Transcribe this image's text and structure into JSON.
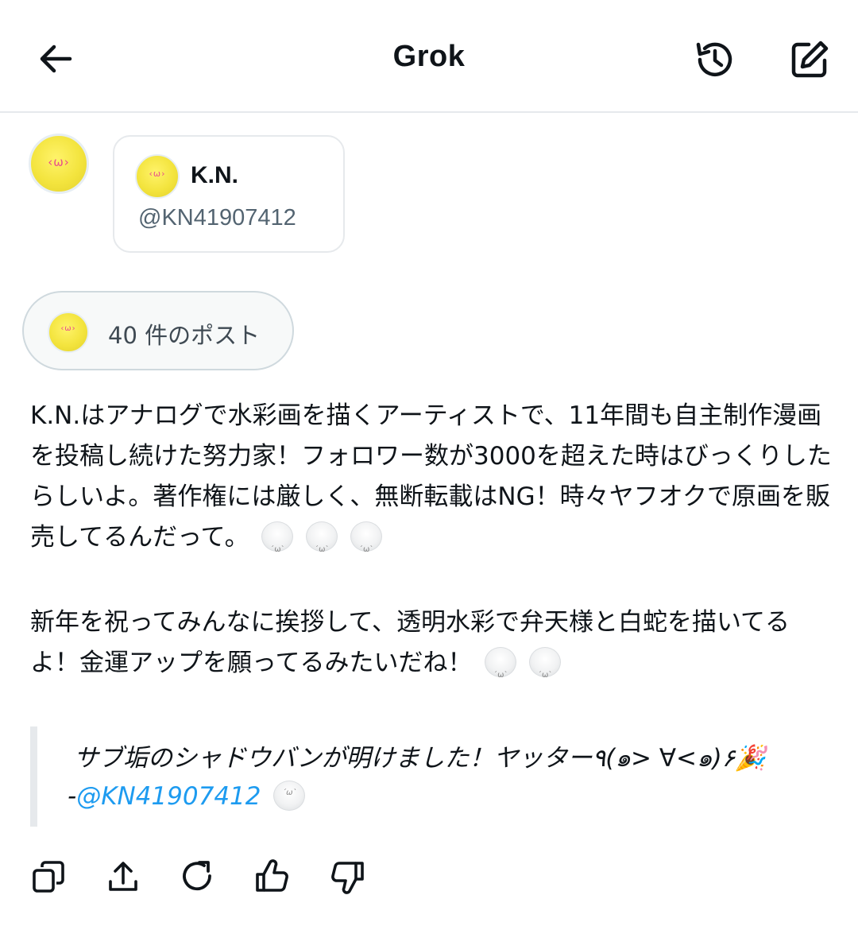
{
  "header": {
    "title": "Grok",
    "back_icon": "arrow-left-icon",
    "history_icon": "history-icon",
    "compose_icon": "compose-icon"
  },
  "user_card": {
    "name": "K.N.",
    "handle": "@KN41907412"
  },
  "posts_chip": {
    "label": "40 件のポスト"
  },
  "response": {
    "paragraph1": "K.N.はアナログで水彩画を描くアーティストで、11年間も自主制作漫画を投稿し続けた努力家！フォロワー数が3000を超えた時はびっくりしたらしいよ。著作権には厳しく、無断転載はNG！時々ヤフオクで原画を販売してるんだって。",
    "paragraph2": "新年を祝ってみんなに挨拶して、透明水彩で弁天様と白蛇を描いてるよ！金運アップを願ってるみたいだね！"
  },
  "quote": {
    "text": "サブ垢のシャドウバンが明けました！ヤッター٩(๑> ∀<๑)۶🎉",
    "dash": "-",
    "link": "@KN41907412"
  },
  "actions": {
    "icons": [
      "copy-icon",
      "share-icon",
      "regenerate-icon",
      "thumbs-up-icon",
      "thumbs-down-icon"
    ]
  },
  "colors": {
    "text": "#0f1419",
    "secondary": "#536471",
    "link": "#1d9bf0",
    "border": "#e6e9ec"
  }
}
